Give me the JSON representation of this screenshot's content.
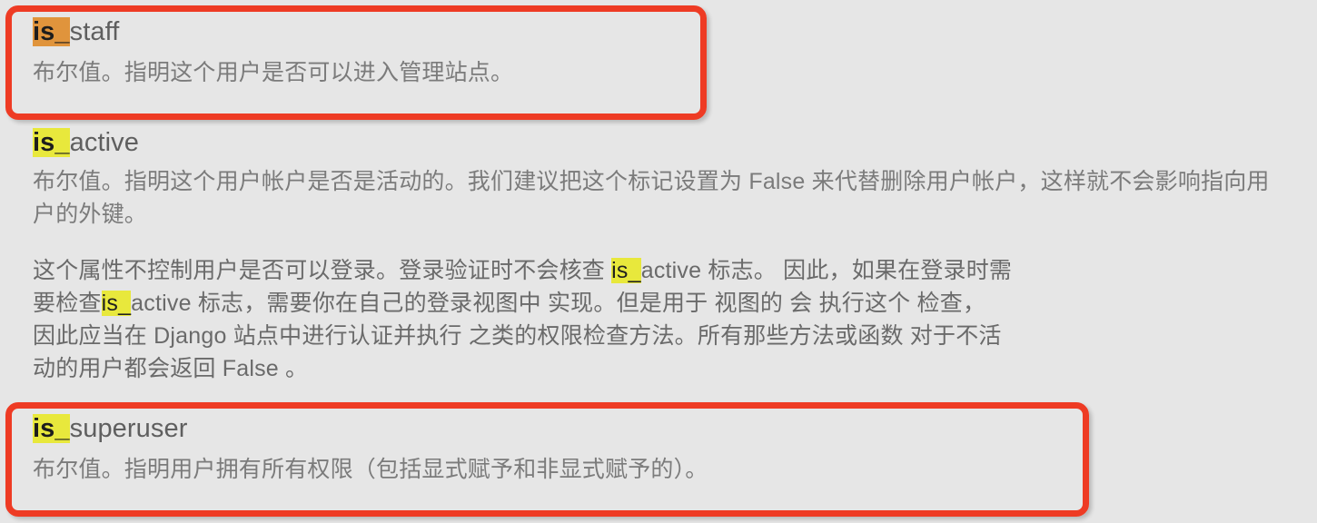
{
  "page": {
    "background_color": "#e6e6e6",
    "body_text_color": "#7b7b7b",
    "annotation_box_color": "#ee3b24",
    "highlight_orange": "#e0943c",
    "highlight_yellow": "#e8e83c"
  },
  "sections": [
    {
      "id": "is_staff",
      "term_highlight": "is_",
      "term_rest": "staff",
      "term_highlight_color": "#e0943c",
      "annotated": true,
      "paragraphs": [
        "布尔值。指明这个用户是否可以进入管理站点。"
      ]
    },
    {
      "id": "is_active",
      "term_highlight": "is_",
      "term_rest": "active",
      "term_highlight_color": "#e8e83c",
      "annotated": false,
      "paragraphs": [
        "布尔值。指明这个用户帐户是否是活动的。我们建议把这个标记设置为 False 来代替删除用户帐户，这样就不会影响指向用户的外键。",
        "这个属性不控制用户是否可以登录。登录验证时不会核查 is_active 标志。 因此，如果在登录时需要检查is_active 标志，需要你在自己的登录视图中 实现。但是用于  视图的  会 执行这个 检查，因此应当在 Django 站点中进行认证并执行  之类的权限检查方法。所有那些方法或函数 对于不活动的用户都会返回 False 。"
      ],
      "paragraph2_lines": [
        {
          "pre": "这个属性不控制用户是否可以登录。登录验证时不会核查 ",
          "highlight": "is_",
          "post": "active 标志。 因此，如果在登录时需"
        },
        {
          "pre": "要检查",
          "highlight": "is_",
          "post": "active 标志，需要你在自己的登录视图中 实现。但是用于  视图的  会 执行这个 检查，"
        },
        {
          "pre": "因此应当在 Django 站点中进行认证并执行  之类的权限检查方法。所有那些方法或函数 对于不活",
          "highlight": "",
          "post": ""
        },
        {
          "pre": "动的用户都会返回 False 。",
          "highlight": "",
          "post": ""
        }
      ]
    },
    {
      "id": "is_superuser",
      "term_highlight": "is_",
      "term_rest": "superuser",
      "term_highlight_color": "#e8e83c",
      "annotated": true,
      "paragraphs": [
        "布尔值。指明用户拥有所有权限（包括显式赋予和非显式赋予的）。"
      ]
    }
  ]
}
